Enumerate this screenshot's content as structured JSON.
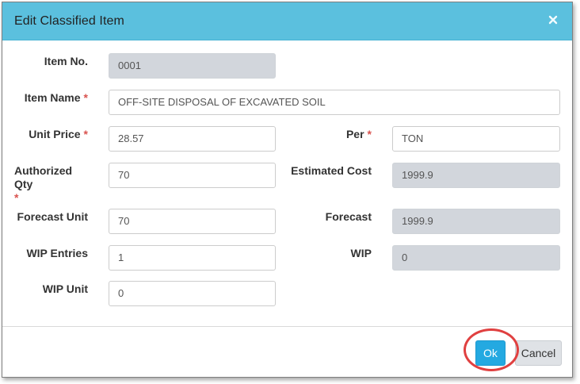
{
  "dialog": {
    "title": "Edit Classified Item",
    "close_symbol": "×"
  },
  "fields": {
    "item_no": {
      "label": "Item No.",
      "value": "0001"
    },
    "item_name": {
      "label": "Item Name",
      "required": "*",
      "value": "OFF-SITE DISPOSAL OF EXCAVATED SOIL"
    },
    "unit_price": {
      "label": "Unit Price",
      "required": "*",
      "value": "28.57"
    },
    "per": {
      "label": "Per",
      "required": "*",
      "value": "TON"
    },
    "authorized_qty": {
      "label": "Authorized Qty",
      "required": "*",
      "value": "70"
    },
    "estimated_cost": {
      "label": "Estimated Cost",
      "value": "1999.9"
    },
    "forecast_unit": {
      "label": "Forecast Unit",
      "value": "70"
    },
    "forecast": {
      "label": "Forecast",
      "value": "1999.9"
    },
    "wip_entries": {
      "label": "WIP Entries",
      "value": "1"
    },
    "wip": {
      "label": "WIP",
      "value": "0"
    },
    "wip_unit": {
      "label": "WIP Unit",
      "value": "0"
    }
  },
  "footer": {
    "ok_label": "Ok",
    "cancel_label": "Cancel"
  },
  "colors": {
    "header": "#5bc0de",
    "ok_button": "#24a9e1",
    "required_mark": "#d9534f",
    "highlight_circle": "#e04040"
  }
}
